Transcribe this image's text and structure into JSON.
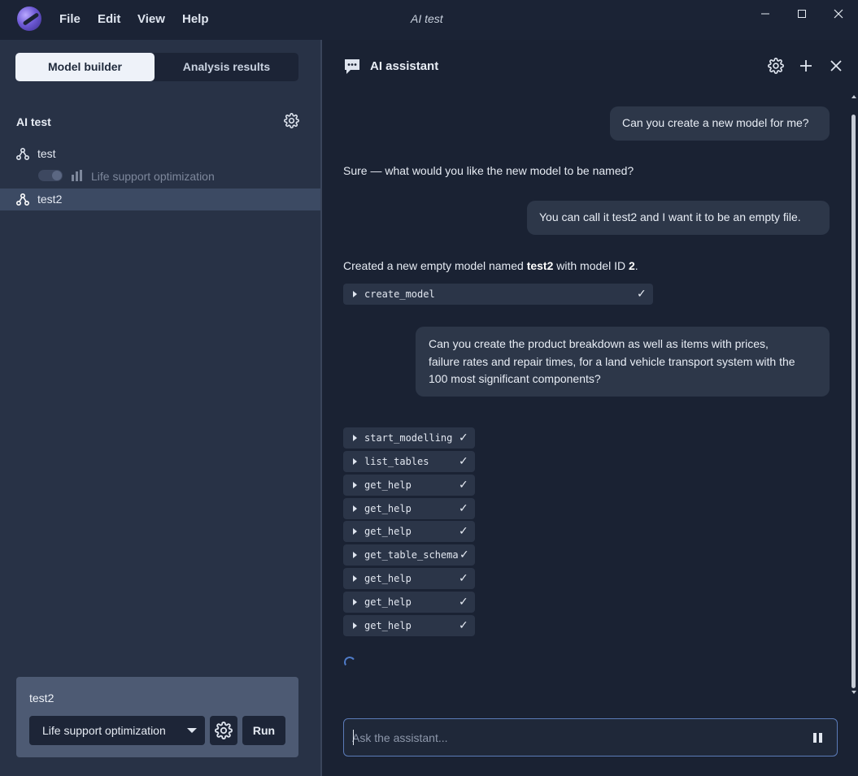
{
  "titlebar": {
    "window_title": "AI test",
    "menu": [
      "File",
      "Edit",
      "View",
      "Help"
    ],
    "controls": [
      "minimize-icon",
      "maximize-icon",
      "close-icon"
    ]
  },
  "left": {
    "tabs": [
      "Model builder",
      "Analysis results"
    ],
    "active_tab": "Model builder",
    "project_title": "AI test",
    "tree": [
      {
        "label": "test",
        "icon": "model-node-icon",
        "selected": false
      },
      {
        "label": "Life support optimization",
        "icon": "bar-chart-icon",
        "child": true,
        "disabled": true
      },
      {
        "label": "test2",
        "icon": "model-node-icon",
        "selected": true
      }
    ],
    "run_card": {
      "title": "test2",
      "analysis_selected": "Life support optimization",
      "run_label": "Run"
    }
  },
  "assistant": {
    "title": "AI assistant",
    "messages": [
      {
        "role": "user",
        "text": "Can you create a new model for me?"
      },
      {
        "role": "assistant",
        "text": "Sure — what would you like the new model to be named?"
      },
      {
        "role": "user",
        "text": "You can call it test2 and I want it to be an empty file."
      },
      {
        "role": "assistant",
        "parts": [
          "Created a new empty model named ",
          "test2",
          " with model ID ",
          "2",
          "."
        ]
      },
      {
        "role": "tool",
        "name": "create_model",
        "status": "✓"
      },
      {
        "role": "user",
        "lines": [
          "Can you create the product breakdown as well as items with prices,",
          "failure rates and repair times, for a land vehicle transport system with the",
          "100 most significant components?"
        ]
      }
    ],
    "tool_calls": [
      {
        "name": "start_modelling",
        "status": "✓"
      },
      {
        "name": "list_tables",
        "status": "✓"
      },
      {
        "name": "get_help",
        "status": "✓"
      },
      {
        "name": "get_help",
        "status": "✓"
      },
      {
        "name": "get_help",
        "status": "✓"
      },
      {
        "name": "get_table_schema",
        "status": "✓"
      },
      {
        "name": "get_help",
        "status": "✓"
      },
      {
        "name": "get_help",
        "status": "✓"
      },
      {
        "name": "get_help",
        "status": "✓"
      }
    ],
    "input_placeholder": "Ask the assistant..."
  },
  "colors": {
    "accent": "#5b7bb8",
    "selected_row": "#3c4a63",
    "panel_left": "#283246",
    "panel_right": "#1a2233"
  }
}
